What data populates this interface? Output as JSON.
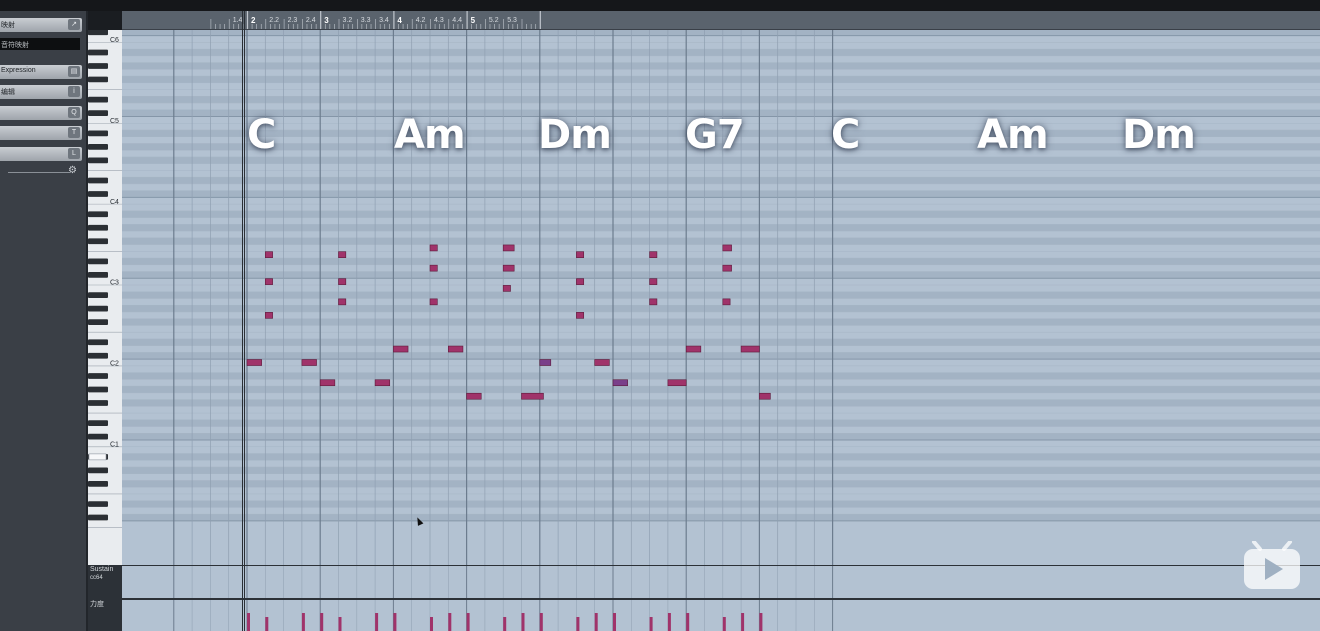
{
  "inspector": {
    "rows": [
      {
        "label": "映射",
        "icon": "arrow-out-icon",
        "glyph": "↗"
      },
      {
        "label": "Expression",
        "icon": "map-icon",
        "glyph": "▤"
      },
      {
        "label": "编辑",
        "icon": "info-icon",
        "glyph": "ⅰ"
      },
      {
        "label": "",
        "icon": "quantize-icon",
        "glyph": "Q"
      },
      {
        "label": "",
        "icon": "transpose-icon",
        "glyph": "T"
      },
      {
        "label": "",
        "icon": "length-icon",
        "glyph": "L"
      }
    ],
    "field_value": "音符映射"
  },
  "keyboard": {
    "octave_labels": [
      "C6",
      "C5",
      "C4",
      "C3",
      "C2",
      "C1"
    ]
  },
  "ruler": {
    "labels": [
      "1.4",
      "2",
      "2.2",
      "2.3",
      "2.4",
      "3",
      "3.2",
      "3.3",
      "3.4",
      "4",
      "4.2",
      "4.3",
      "4.4",
      "5",
      "5.2",
      "5.3"
    ]
  },
  "chords": [
    "C",
    "Am",
    "Dm",
    "G7",
    "C",
    "Am",
    "Dm"
  ],
  "notes": [
    {
      "pitch": "C2",
      "start": 2.0,
      "length": 0.2
    },
    {
      "pitch": "E3",
      "start": 2.25,
      "length": 0.1
    },
    {
      "pitch": "C3",
      "start": 2.25,
      "length": 0.1
    },
    {
      "pitch": "G2",
      "start": 2.25,
      "length": 0.1
    },
    {
      "pitch": "C2",
      "start": 2.75,
      "length": 0.2
    },
    {
      "pitch": "A1",
      "start": 3.0,
      "length": 0.2
    },
    {
      "pitch": "E3",
      "start": 3.25,
      "length": 0.1
    },
    {
      "pitch": "C3",
      "start": 3.25,
      "length": 0.1
    },
    {
      "pitch": "A2",
      "start": 3.25,
      "length": 0.1
    },
    {
      "pitch": "A1",
      "start": 3.75,
      "length": 0.2
    },
    {
      "pitch": "D2",
      "start": 4.0,
      "length": 0.2
    },
    {
      "pitch": "F3",
      "start": 4.5,
      "length": 0.1
    },
    {
      "pitch": "D3",
      "start": 4.5,
      "length": 0.1
    },
    {
      "pitch": "A2",
      "start": 4.5,
      "length": 0.1
    },
    {
      "pitch": "D2",
      "start": 4.75,
      "length": 0.2
    },
    {
      "pitch": "G1",
      "start": 5.0,
      "length": 0.2
    },
    {
      "pitch": "F3",
      "start": 5.5,
      "length": 0.15
    },
    {
      "pitch": "D3",
      "start": 5.5,
      "length": 0.15
    },
    {
      "pitch": "B2",
      "start": 5.5,
      "length": 0.1
    },
    {
      "pitch": "G1",
      "start": 5.75,
      "length": 0.3
    },
    {
      "pitch": "C2",
      "start": 6.0,
      "length": 0.15
    },
    {
      "pitch": "E3",
      "start": 6.5,
      "length": 0.1
    },
    {
      "pitch": "C3",
      "start": 6.5,
      "length": 0.1
    },
    {
      "pitch": "G2",
      "start": 6.5,
      "length": 0.1
    },
    {
      "pitch": "C2",
      "start": 6.75,
      "length": 0.2
    },
    {
      "pitch": "A1",
      "start": 7.0,
      "length": 0.2
    },
    {
      "pitch": "E3",
      "start": 7.5,
      "length": 0.1
    },
    {
      "pitch": "C3",
      "start": 7.5,
      "length": 0.1
    },
    {
      "pitch": "A2",
      "start": 7.5,
      "length": 0.1
    },
    {
      "pitch": "A1",
      "start": 7.75,
      "length": 0.25
    },
    {
      "pitch": "D2",
      "start": 8.0,
      "length": 0.2
    },
    {
      "pitch": "F3",
      "start": 8.5,
      "length": 0.12
    },
    {
      "pitch": "D3",
      "start": 8.5,
      "length": 0.12
    },
    {
      "pitch": "A2",
      "start": 8.5,
      "length": 0.1
    },
    {
      "pitch": "D2",
      "start": 8.75,
      "length": 0.25
    },
    {
      "pitch": "G1",
      "start": 9.0,
      "length": 0.15
    }
  ],
  "lanes": {
    "sustain_label": "Sustain",
    "sustain_sub": "cc64",
    "velocity_label": "力度"
  },
  "colors": {
    "note": "#a0336a",
    "note_alt": "#7a3f8a",
    "grid_bg": "#b3c2d2",
    "grid_black_row": "#a3b3c4"
  }
}
